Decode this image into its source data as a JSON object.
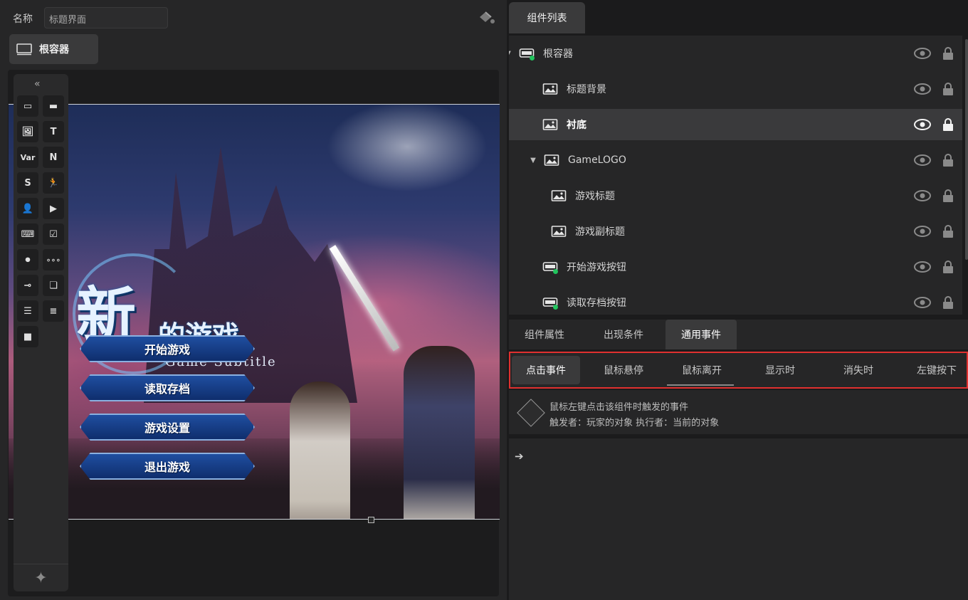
{
  "editor": {
    "name_label": "名称",
    "name_value": "标题界面",
    "root_tab_label": "根容器"
  },
  "toolbox": {
    "collapse_label": "«",
    "items": [
      {
        "icon": "container-icon",
        "glyph": "▭"
      },
      {
        "icon": "button-icon",
        "glyph": "▬"
      },
      {
        "icon": "image-icon",
        "glyph": "🖼"
      },
      {
        "icon": "text-icon",
        "glyph": "T"
      },
      {
        "icon": "var-icon",
        "glyph": "Var"
      },
      {
        "icon": "number-icon",
        "glyph": "N"
      },
      {
        "icon": "string-icon",
        "glyph": "S"
      },
      {
        "icon": "run-icon",
        "glyph": "🏃"
      },
      {
        "icon": "character-icon",
        "glyph": "👤"
      },
      {
        "icon": "video-icon",
        "glyph": "▶"
      },
      {
        "icon": "input-icon",
        "glyph": "⌨"
      },
      {
        "icon": "checkbox-icon",
        "glyph": "☑"
      },
      {
        "icon": "toggle-icon",
        "glyph": "⏺"
      },
      {
        "icon": "pagination-icon",
        "glyph": "∘∘∘"
      },
      {
        "icon": "slider-icon",
        "glyph": "⊸"
      },
      {
        "icon": "cards-icon",
        "glyph": "❏"
      },
      {
        "icon": "document-icon",
        "glyph": "☰"
      },
      {
        "icon": "list-icon",
        "glyph": "≡"
      },
      {
        "icon": "camera-icon",
        "glyph": "■"
      }
    ],
    "sparkle": "✦"
  },
  "preview": {
    "logo_big": "新",
    "logo_small": "的游戏",
    "logo_subtitle": "Game Subtitle",
    "menu_buttons": [
      "开始游戏",
      "读取存档",
      "游戏设置",
      "退出游戏"
    ]
  },
  "component_list": {
    "tab_label": "组件列表",
    "items": [
      {
        "label": "根容器",
        "icon": "container-icon",
        "caret": "▼",
        "indent": 0,
        "selected": false,
        "green_dot": true
      },
      {
        "label": "标题背景",
        "icon": "image-icon",
        "caret": "",
        "indent": 1,
        "selected": false,
        "green_dot": false
      },
      {
        "label": "衬底",
        "icon": "image-icon",
        "caret": "",
        "indent": 1,
        "selected": true,
        "green_dot": false
      },
      {
        "label": "GameLOGO",
        "icon": "image-icon",
        "caret": "▼",
        "indent": 1,
        "selected": false,
        "green_dot": false
      },
      {
        "label": "游戏标题",
        "icon": "image-icon",
        "caret": "",
        "indent": 2,
        "selected": false,
        "green_dot": false
      },
      {
        "label": "游戏副标题",
        "icon": "image-icon",
        "caret": "",
        "indent": 2,
        "selected": false,
        "green_dot": false
      },
      {
        "label": "开始游戏按钮",
        "icon": "button-icon",
        "caret": "",
        "indent": 1,
        "selected": false,
        "green_dot": true
      },
      {
        "label": "读取存档按钮",
        "icon": "button-icon",
        "caret": "",
        "indent": 1,
        "selected": false,
        "green_dot": true
      }
    ]
  },
  "property_tabs": {
    "items": [
      "组件属性",
      "出现条件",
      "通用事件"
    ],
    "active": "通用事件"
  },
  "event_tabs": {
    "items": [
      "点击事件",
      "鼠标悬停",
      "鼠标离开",
      "显示时",
      "消失时",
      "左键按下"
    ],
    "active": "点击事件"
  },
  "event_description": {
    "line1": "鼠标左键点击该组件时触发的事件",
    "line2": "触发者：玩家的对象 执行者：当前的对象"
  },
  "actions": {
    "arrow": "➔"
  },
  "colors": {
    "highlight_border": "#e0302f",
    "selected_row": "#3a3a3c",
    "active_dot": "#22c55e"
  }
}
